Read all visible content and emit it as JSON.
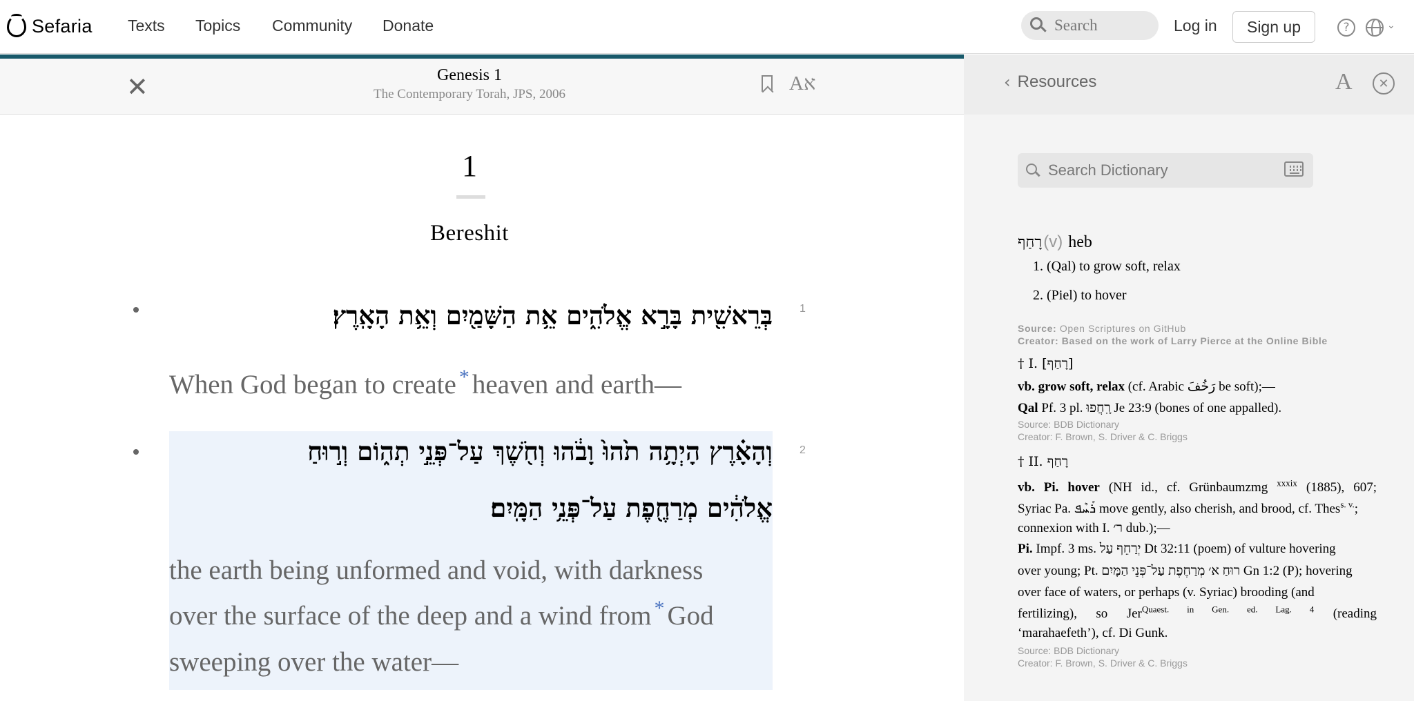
{
  "nav": {
    "logo_text": "Sefaria",
    "links": [
      "Texts",
      "Topics",
      "Community",
      "Donate"
    ],
    "search_placeholder": "Search",
    "login": "Log in",
    "signup": "Sign up",
    "help_glyph": "?",
    "lang_chevron": "⌄"
  },
  "reader": {
    "title": "Genesis 1",
    "subtitle": "The Contemporary Torah, JPS, 2006",
    "font_toggle": "Aא",
    "close_glyph": "✕",
    "chapter_number": "1",
    "chapter_name": "Bereshit",
    "verses": [
      {
        "num": "1",
        "hebrew": [
          "בְּרֵאשִׁ֖ית בָּרָ֣א אֱלֹהִ֑ים אֵ֥ת הַשָּׁמַ֖יִם וְאֵ֥ת הָאָֽרֶץ׃"
        ],
        "english_before": "When God began to create",
        "footnote": "*",
        "english_after": "heaven and earth—"
      },
      {
        "num": "2",
        "hebrew": [
          "וְהָאָ֗רֶץ הָיְתָ֥ה תֹ֙הוּ֙ וָבֹ֔הוּ וְחֹ֖שֶׁךְ עַל־פְּנֵ֣י תְה֑וֹם וְר֣וּחַ",
          "אֱלֹהִ֔ים מְרַחֶ֖פֶת עַל־פְּנֵ֥י הַמָּֽיִם׃"
        ],
        "english_lines": [
          "the earth being unformed and void, with darkness",
          "over the surface of the deep and a wind from",
          "God",
          "sweeping over the water—"
        ],
        "footnote": "*"
      }
    ]
  },
  "resources": {
    "back_label": "Resources",
    "back_glyph": "‹",
    "font_glyph": "A",
    "close_glyph": "✕",
    "dict_placeholder": "Search Dictionary",
    "entry": {
      "headword": "רָחַף",
      "pos": "(v)",
      "lang": "heb",
      "senses": [
        "1. (Qal) to grow soft, relax",
        "2. (Piel) to hover"
      ],
      "source_label": "Source:",
      "source_value": "Open Scriptures on GitHub",
      "creator_label": "Creator:",
      "creator_value": "Based on the work of Larry Pierce at the Online Bible"
    },
    "bdb1": {
      "head": "† I. [רָחַף]",
      "line1_bold": "vb. grow soft, relax",
      "line1_rest": " (cf. Arabic رَخُفَ be soft);—",
      "line2_bold": "Qal",
      "line2_rest": " Pf. 3 pl. רָֽחֲפוּ Je 23:9 (bones of one appalled).",
      "source": "Source: BDB Dictionary",
      "creator": "Creator: F. Brown, S. Driver & C. Briggs"
    },
    "bdb2": {
      "head": "† II. רָחַף",
      "line1_bold": "vb. Pi. hover",
      "line1_rest": " (NH id., cf. Grünbaumzmg",
      "line1_sup": "xxxix",
      "line1_tail": "(1885), 607;",
      "line2": "Syriac Pa. ܪܰܚܶܦ move gently, also cherish, and brood, cf. Thes",
      "line2_sup": "s. v.",
      "line2_tail": ";",
      "line3": "connexion with I. ר׳ dub.);—",
      "line4_bold": "Pi.",
      "line4_rest": " Impf. 3 ms. יְרַחֵף עַל Dt 32:11 (poem) of vulture hovering",
      "line5": "over young; Pt. רוּחַ א׳ מְרַחֶפֶת עַל־פְּנֵי הַמָּיִם Gn 1:2 (P); hovering",
      "line6": "over face of waters, or perhaps (v. Syriac) brooding (and",
      "line7_a": "fertilizing), so Jer",
      "line7_sup": "Quaest. in Gen. ed. Lag. 4",
      "line7_b": "(reading",
      "line8": "‘marahaefeth’), cf. Di Gunk.",
      "source": "Source: BDB Dictionary",
      "creator": "Creator: F. Brown, S. Driver & C. Briggs"
    }
  }
}
